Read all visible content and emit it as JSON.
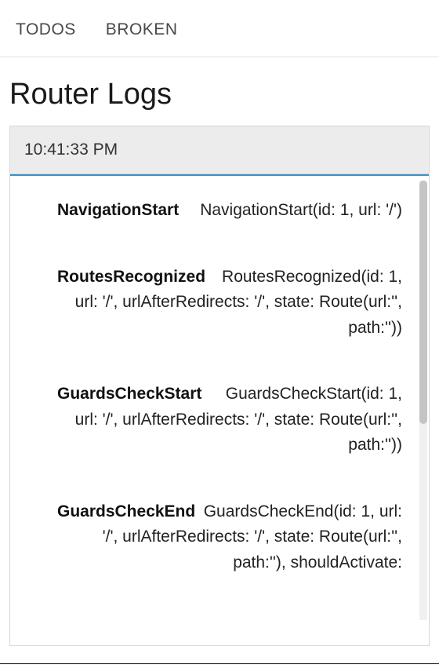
{
  "nav": {
    "items": [
      {
        "label": "TODOS"
      },
      {
        "label": "BROKEN"
      }
    ]
  },
  "page": {
    "title": "Router Logs"
  },
  "log": {
    "timestamp": "10:41:33 PM",
    "entries": [
      {
        "event": "NavigationStart",
        "detail": "NavigationStart(id: 1, url: '/')"
      },
      {
        "event": "RoutesRecognized",
        "detail": "RoutesRecognized(id: 1, url: '/', urlAfterRedirects: '/', state: Route(url:'', path:''))"
      },
      {
        "event": "GuardsCheckStart",
        "detail": "GuardsCheckStart(id: 1, url: '/', urlAfterRedirects: '/', state: Route(url:'', path:''))"
      },
      {
        "event": "GuardsCheckEnd",
        "detail": "GuardsCheckEnd(id: 1, url: '/', urlAfterRedirects: '/', state: Route(url:'', path:''), shouldActivate:"
      }
    ]
  }
}
